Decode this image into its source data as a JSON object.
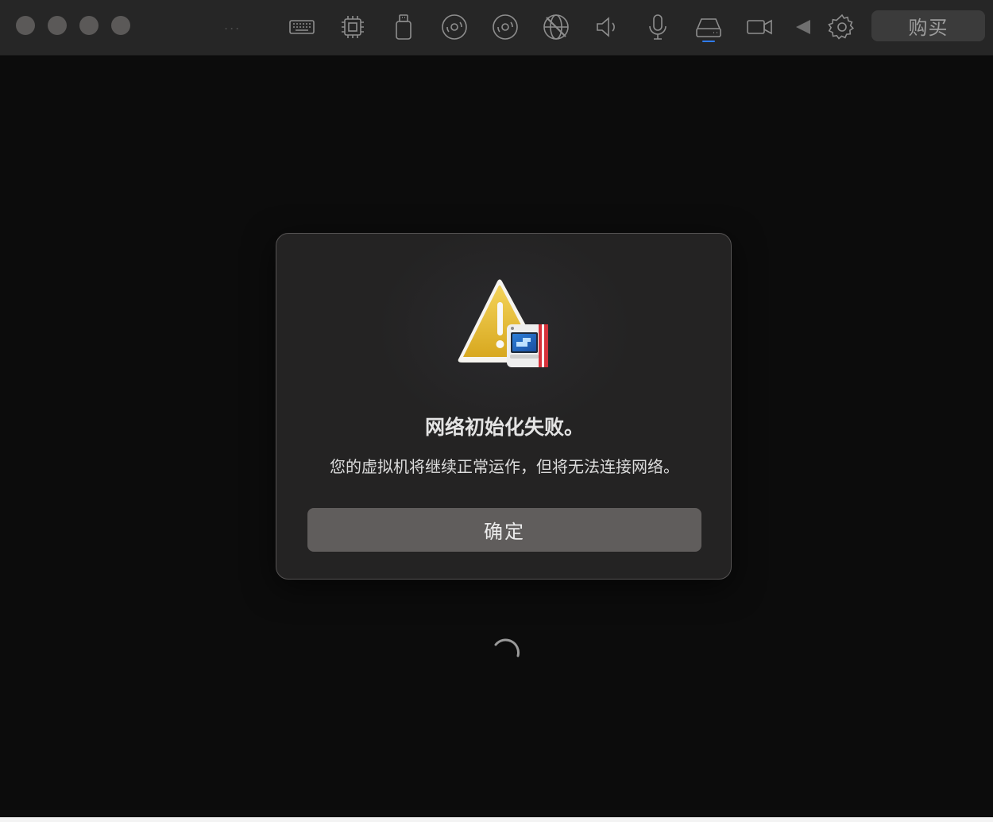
{
  "toolbar": {
    "buy_label": "购买",
    "dots": "...",
    "tools": [
      {
        "icon": "keyboard-icon"
      },
      {
        "icon": "cpu-icon"
      },
      {
        "icon": "usb-drive-icon"
      },
      {
        "icon": "disc-icon"
      },
      {
        "icon": "disc-icon"
      },
      {
        "icon": "network-disabled-icon"
      },
      {
        "icon": "speaker-icon"
      },
      {
        "icon": "microphone-icon"
      },
      {
        "icon": "hard-drive-icon"
      },
      {
        "icon": "camera-icon"
      },
      {
        "icon": "play-back-icon"
      },
      {
        "icon": "gear-icon"
      }
    ],
    "active_tool": "hard-drive-icon"
  },
  "dialog": {
    "title": "网络初始化失败。",
    "message": "您的虚拟机将继续正常运作，但将无法连接网络。",
    "ok_label": "确定",
    "icon": "warning-triangle-icon"
  },
  "colors": {
    "accent": "#2f7cf6",
    "warning": "#e8b930",
    "window_bg": "#0c0c0c",
    "toolbar_bg": "#262626"
  }
}
